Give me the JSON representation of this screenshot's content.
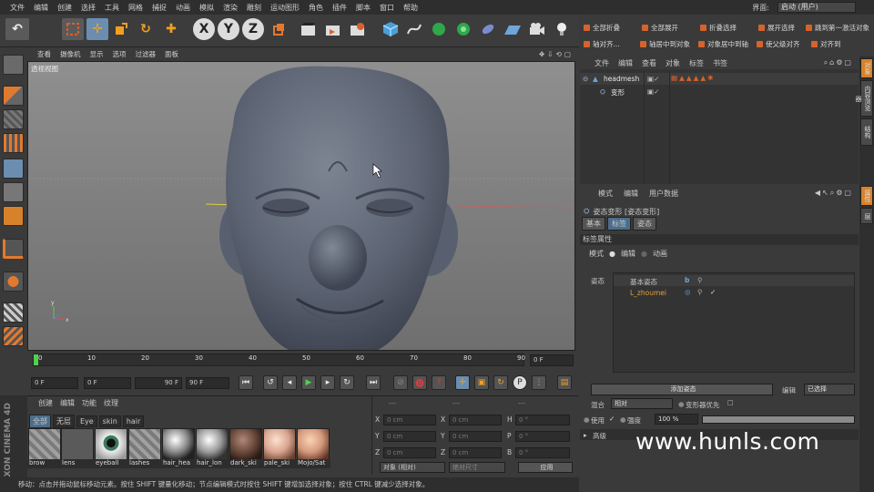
{
  "menubar": {
    "items": [
      "文件",
      "编辑",
      "创建",
      "选择",
      "工具",
      "网格",
      "捕捉",
      "动画",
      "模拟",
      "渲染",
      "雕刻",
      "运动图形",
      "角色",
      "插件",
      "脚本",
      "窗口",
      "帮助"
    ],
    "layout_label": "界面:",
    "layout_value": "启动 (用户)"
  },
  "right_toolbar": {
    "row1": [
      "全部折叠",
      "全部展开",
      "折叠选择",
      "展开选择",
      "跳到第一激活对象"
    ],
    "row2": [
      "轴对齐...",
      "轴居中到对象",
      "对象居中到轴",
      "使父级对齐",
      "对齐到"
    ]
  },
  "viewport": {
    "menu": [
      "查看",
      "摄像机",
      "显示",
      "选项",
      "过滤器",
      "面板"
    ],
    "label": "透视视图"
  },
  "timeline": {
    "ticks": [
      "0",
      "10",
      "20",
      "30",
      "40",
      "50",
      "60",
      "70",
      "80",
      "90"
    ],
    "current": "0 F",
    "start": "0 F",
    "range_start": "0 F",
    "range_end": "90 F",
    "end": "90 F"
  },
  "materials": {
    "menu": [
      "创建",
      "编辑",
      "功能",
      "纹理"
    ],
    "filters": [
      "全部",
      "无层",
      "Eye",
      "skin",
      "hair"
    ],
    "items": [
      {
        "label": "brow",
        "color": "#9a9a9a"
      },
      {
        "label": "lens",
        "color": "#666666"
      },
      {
        "label": "eyeball",
        "color": "#eeeeee"
      },
      {
        "label": "lashes",
        "color": "#9a9a9a"
      },
      {
        "label": "hair_hea",
        "color": "#c9c9c9"
      },
      {
        "label": "hair_lon",
        "color": "#cccccc"
      },
      {
        "label": "dark_ski",
        "color": "#6b4a3c"
      },
      {
        "label": "pale_ski",
        "color": "#d9a690"
      },
      {
        "label": "Mojo/Sat",
        "color": "#d49a7c"
      }
    ]
  },
  "coords": {
    "headers": [
      "---",
      "---",
      "---"
    ],
    "rows": [
      {
        "a": "X",
        "av": "0 cm",
        "b": "X",
        "bv": "0 cm",
        "c": "H",
        "cv": "0 °"
      },
      {
        "a": "Y",
        "av": "0 cm",
        "b": "Y",
        "bv": "0 cm",
        "c": "P",
        "cv": "0 °"
      },
      {
        "a": "Z",
        "av": "0 cm",
        "b": "Z",
        "bv": "0 cm",
        "c": "B",
        "cv": "0 °"
      }
    ],
    "mode": "对象 (相对)",
    "size_mode": "绝对尺寸",
    "apply": "应用"
  },
  "status": "移动：点击并拖动鼠标移动元素。按住 SHIFT 键量化移动；节点编辑模式时按住 SHIFT 键增加选择对象；按住 CTRL 键减少选择对象。",
  "objects": {
    "menu": [
      "文件",
      "编辑",
      "查看",
      "对象",
      "标签",
      "书签"
    ],
    "items": [
      {
        "name": "headmesh"
      },
      {
        "name": "变形"
      }
    ]
  },
  "attributes": {
    "menu": [
      "模式",
      "编辑",
      "用户数据"
    ],
    "title": "姿态变形 [姿态变形]",
    "tabs": [
      "基本",
      "标签",
      "姿态"
    ],
    "section": "标签属性",
    "mode_label": "模式",
    "mode_edit": "编辑",
    "mode_anim": "动画",
    "pose_label": "姿态",
    "pose_base": "基本姿态",
    "pose_item": "L_zhoumei",
    "add_pose": "添加姿态",
    "edit_label": "编辑",
    "edit_value": "已选择",
    "blend_label": "混合",
    "blend_value": "相对",
    "deformer_priority": "变形器优先",
    "use_label": "使用",
    "strength_label": "强度",
    "strength_value": "100 %",
    "strength_fraction": 1.0,
    "advanced": "高级"
  },
  "right_tabs": [
    "对象",
    "内容浏览器",
    "结构",
    "属性",
    "层"
  ],
  "watermark": "www.hunls.com",
  "brand": "MAXON CINEMA 4D",
  "colors": {
    "accent": "#d7622b",
    "selection": "#5a7d9a",
    "active_tab": "#4d6e8a"
  }
}
